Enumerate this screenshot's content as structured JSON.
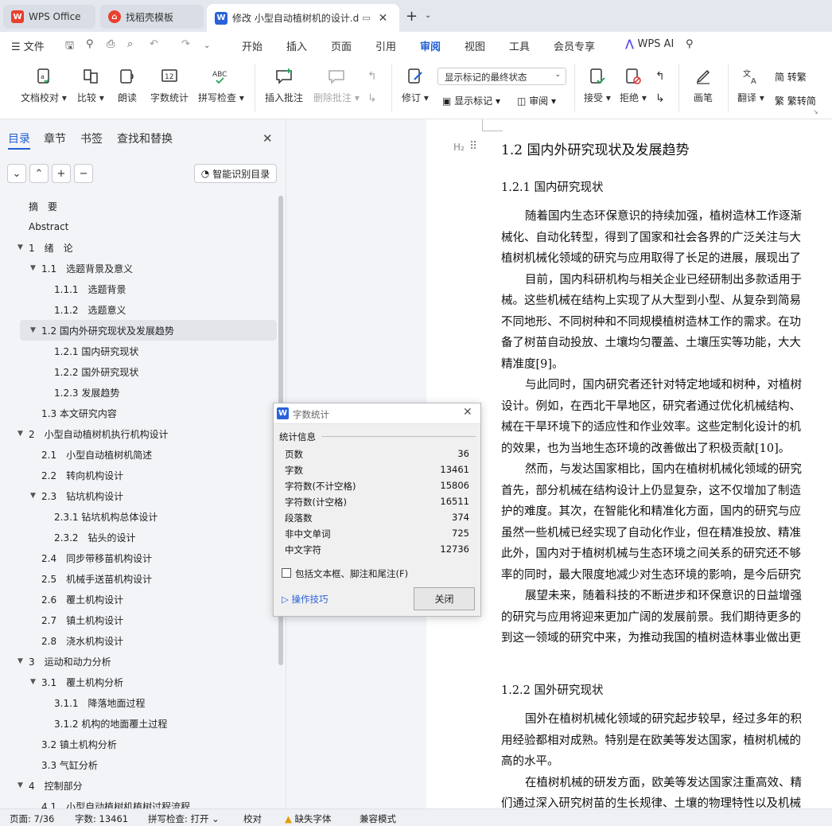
{
  "tabs": [
    {
      "label": "WPS Office"
    },
    {
      "label": "找稻壳模板"
    },
    {
      "label": "修改 小型自动植树机的设计.d"
    }
  ],
  "menu": {
    "file": "文件",
    "items": [
      "开始",
      "插入",
      "页面",
      "引用",
      "审阅",
      "视图",
      "工具",
      "会员专享"
    ],
    "ai": "WPS AI"
  },
  "ribbon": {
    "doc_check": "文档校对",
    "compare": "比较",
    "read_aloud": "朗读",
    "word_count": "字数统计",
    "spell_check": "拼写检查",
    "insert_comment": "插入批注",
    "delete_comment": "删除批注",
    "revise": "修订",
    "display_mode": "显示标记的最终状态",
    "show_markup": "显示标记",
    "review": "审阅",
    "accept": "接受",
    "reject": "拒绝",
    "pen": "画笔",
    "translate": "翻译",
    "to_traditional": "转繁",
    "to_simplified": "繁转简",
    "icon_abc": "ABC",
    "icon_12": "12"
  },
  "sidebar": {
    "tabs": [
      "目录",
      "章节",
      "书签",
      "查找和替换"
    ],
    "smart_toc": "智能识别目录",
    "toc": [
      {
        "text": "摘　要",
        "level": 0
      },
      {
        "text": "Abstract",
        "level": 0
      },
      {
        "text": "1　绪　论",
        "level": 0,
        "arrow": true
      },
      {
        "text": "1.1　选题背景及意义",
        "level": 1,
        "arrow": true
      },
      {
        "text": "1.1.1　选题背景",
        "level": 2
      },
      {
        "text": "1.1.2　选题意义",
        "level": 2
      },
      {
        "text": "1.2 国内外研究现状及发展趋势",
        "level": 1,
        "arrow": true,
        "selected": true
      },
      {
        "text": "1.2.1 国内研究现状",
        "level": 2
      },
      {
        "text": "1.2.2 国外研究现状",
        "level": 2
      },
      {
        "text": "1.2.3 发展趋势",
        "level": 2
      },
      {
        "text": "1.3 本文研究内容",
        "level": 1
      },
      {
        "text": "2　小型自动植树机执行机构设计",
        "level": 0,
        "arrow": true
      },
      {
        "text": "2.1　小型自动植树机简述",
        "level": 1
      },
      {
        "text": "2.2　转向机构设计",
        "level": 1
      },
      {
        "text": "2.3　钻坑机构设计",
        "level": 1,
        "arrow": true
      },
      {
        "text": "2.3.1 钻坑机构总体设计",
        "level": 2
      },
      {
        "text": "2.3.2　钻头的设计",
        "level": 2
      },
      {
        "text": "2.4　同步带移苗机构设计",
        "level": 1
      },
      {
        "text": "2.5　机械手送苗机构设计",
        "level": 1
      },
      {
        "text": "2.6　覆土机构设计",
        "level": 1
      },
      {
        "text": "2.7　镇土机构设计",
        "level": 1
      },
      {
        "text": "2.8　浇水机构设计",
        "level": 1
      },
      {
        "text": "3　运动和动力分析",
        "level": 0,
        "arrow": true
      },
      {
        "text": "3.1　覆土机构分析",
        "level": 1,
        "arrow": true
      },
      {
        "text": "3.1.1　降落地面过程",
        "level": 2
      },
      {
        "text": "3.1.2 机构的地面覆土过程",
        "level": 2
      },
      {
        "text": "3.2 镇土机构分析",
        "level": 1
      },
      {
        "text": "3.3 气缸分析",
        "level": 1
      },
      {
        "text": "4　控制部分",
        "level": 0,
        "arrow": true
      },
      {
        "text": "4.1　小型自动植树机植树过程流程",
        "level": 1
      }
    ]
  },
  "document": {
    "h2_marker": "H₂",
    "heading": "1.2  国内外研究现状及发展趋势",
    "sub1": "1.2.1  国内研究现状",
    "lines1": [
      {
        "t": "随着国内生态环保意识的持续加强，植树造林工作逐渐",
        "indent": true
      },
      {
        "t": "械化、自动化转型，得到了国家和社会各界的广泛关注与大"
      },
      {
        "t": "植树机械化领域的研究与应用取得了长足的进展，展现出了"
      },
      {
        "t": "目前，国内科研机构与相关企业已经研制出多款适用于",
        "indent": true
      },
      {
        "t": "械。这些机械在结构上实现了从大型到小型、从复杂到简易"
      },
      {
        "t": "不同地形、不同树种和不同规模植树造林工作的需求。在功"
      },
      {
        "t": "备了树苗自动投放、土壤均匀覆盖、土壤压实等功能，大大"
      },
      {
        "t": "精准度[9]。"
      },
      {
        "t": "与此同时，国内研究者还针对特定地域和树种，对植树",
        "indent": true
      },
      {
        "t": "设计。例如，在西北干旱地区，研究者通过优化机械结构、"
      },
      {
        "t": "械在干旱环境下的适应性和作业效率。这些定制化设计的机"
      },
      {
        "t": "的效果，也为当地生态环境的改善做出了积极贡献[10]。"
      },
      {
        "t": "然而，与发达国家相比，国内在植树机械化领域的研究",
        "indent": true
      },
      {
        "t": "首先，部分机械在结构设计上仍显复杂，这不仅增加了制造"
      },
      {
        "t": "护的难度。其次，在智能化和精准化方面，国内的研究与应"
      },
      {
        "t": "虽然一些机械已经实现了自动化作业，但在精准投放、精准"
      },
      {
        "t": "此外，国内对于植树机械与生态环境之间关系的研究还不够"
      },
      {
        "t": "率的同时，最大限度地减少对生态环境的影响，是今后研究"
      },
      {
        "t": "展望未来，随着科技的不断进步和环保意识的日益增强",
        "indent": true
      },
      {
        "t": "的研究与应用将迎来更加广阔的发展前景。我们期待更多的"
      },
      {
        "t": "到这一领域的研究中来，为推动我国的植树造林事业做出更"
      }
    ],
    "sub2": "1.2.2  国外研究现状",
    "lines2": [
      {
        "t": "国外在植树机械化领域的研究起步较早，经过多年的积",
        "indent": true
      },
      {
        "t": "用经验都相对成熟。特别是在欧美等发达国家，植树机械的"
      },
      {
        "t": "高的水平。"
      },
      {
        "t": "在植树机械的研发方面，欧美等发达国家注重高效、精",
        "indent": true
      },
      {
        "t": "们通过深入研究树苗的生长规律、土壤的物理特性以及机械"
      }
    ]
  },
  "dialog": {
    "title": "字数统计",
    "section": "统计信息",
    "rows": [
      {
        "label": "页数",
        "value": "36"
      },
      {
        "label": "字数",
        "value": "13461"
      },
      {
        "label": "字符数(不计空格)",
        "value": "15806"
      },
      {
        "label": "字符数(计空格)",
        "value": "16511"
      },
      {
        "label": "段落数",
        "value": "374"
      },
      {
        "label": "非中文单词",
        "value": "725"
      },
      {
        "label": "中文字符",
        "value": "12736"
      }
    ],
    "checkbox": "包括文本框、脚注和尾注(F)",
    "tips": "操作技巧",
    "close": "关闭"
  },
  "status": {
    "page": "页面: 7/36",
    "words": "字数: 13461",
    "spell": "拼写检查: 打开",
    "proof": "校对",
    "font_missing": "缺失字体",
    "compat": "兼容模式"
  },
  "colors": {
    "accent": "#1f5ed6",
    "wps_red": "#e8402d"
  }
}
